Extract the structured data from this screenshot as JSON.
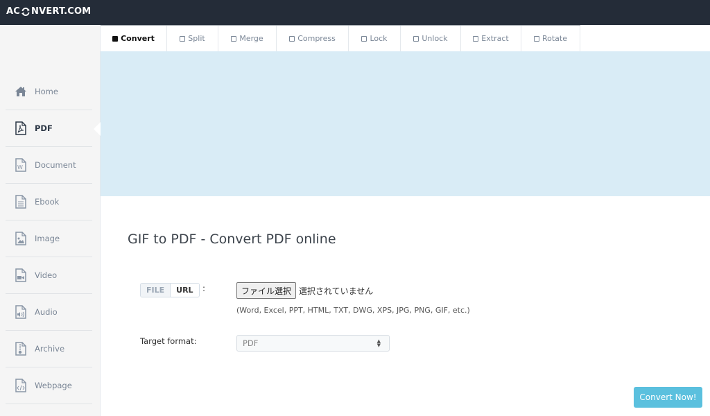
{
  "brand": {
    "logo_left": "AC",
    "logo_right": "NVERT.COM"
  },
  "tabs": [
    {
      "label": "Convert",
      "active": true
    },
    {
      "label": "Split",
      "active": false
    },
    {
      "label": "Merge",
      "active": false
    },
    {
      "label": "Compress",
      "active": false
    },
    {
      "label": "Lock",
      "active": false
    },
    {
      "label": "Unlock",
      "active": false
    },
    {
      "label": "Extract",
      "active": false
    },
    {
      "label": "Rotate",
      "active": false
    }
  ],
  "sidebar": {
    "items": [
      {
        "label": "Home",
        "icon": "home-icon"
      },
      {
        "label": "PDF",
        "icon": "pdf-file-icon",
        "active": true
      },
      {
        "label": "Document",
        "icon": "word-file-icon"
      },
      {
        "label": "Ebook",
        "icon": "text-file-icon"
      },
      {
        "label": "Image",
        "icon": "image-file-icon"
      },
      {
        "label": "Video",
        "icon": "video-file-icon"
      },
      {
        "label": "Audio",
        "icon": "audio-file-icon"
      },
      {
        "label": "Archive",
        "icon": "archive-file-icon"
      },
      {
        "label": "Webpage",
        "icon": "code-file-icon"
      }
    ]
  },
  "main": {
    "title": "GIF to PDF - Convert PDF online",
    "source_toggle": {
      "file": "FILE",
      "url": "URL",
      "colon": ":"
    },
    "file_input": {
      "button": "ファイル選択",
      "status": "選択されていません"
    },
    "hint": "(Word, Excel, PPT, HTML, TXT, DWG, XPS, JPG, PNG, GIF, etc.)",
    "target_format": {
      "label": "Target format:",
      "value": "PDF"
    },
    "convert_button": "Convert Now!"
  },
  "colors": {
    "topbar": "#242c38",
    "ad_area": "#d9ecf6",
    "accent": "#5bc0de"
  }
}
